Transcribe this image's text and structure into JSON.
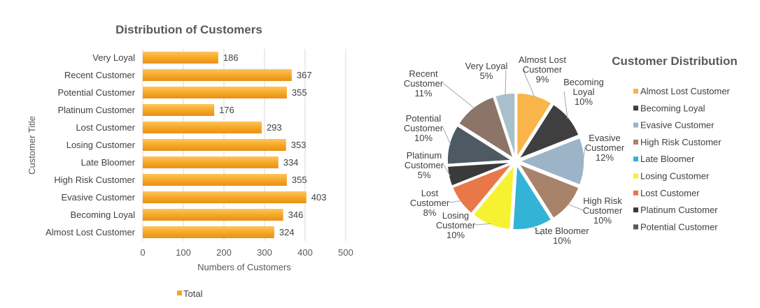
{
  "chart_data": [
    {
      "type": "bar",
      "orientation": "horizontal",
      "title": "Distribution of Customers",
      "xlabel": "Numbers of Customers",
      "ylabel": "Customer Title",
      "xlim": [
        0,
        500
      ],
      "xticks": [
        0,
        100,
        200,
        300,
        400,
        500
      ],
      "grid": true,
      "legend": "bottom",
      "categories": [
        "Very Loyal",
        "Recent Customer",
        "Potential Customer",
        "Platinum Customer",
        "Lost Customer",
        "Losing Customer",
        "Late Bloomer",
        "High Risk Customer",
        "Evasive Customer",
        "Becoming Loyal",
        "Almost Lost Customer"
      ],
      "series": [
        {
          "name": "Total",
          "color": "#f5a623",
          "values": [
            186,
            367,
            355,
            176,
            293,
            353,
            334,
            355,
            403,
            346,
            324
          ]
        }
      ]
    },
    {
      "type": "pie",
      "exploded": true,
      "title": "Customer Distribution",
      "legend": "right",
      "slices": [
        {
          "name": "Almost Lost Customer",
          "label_lines": [
            "Almost Lost",
            "Customer",
            "9%"
          ],
          "percent": 9,
          "color": "#f9b44a"
        },
        {
          "name": "Becoming Loyal",
          "label_lines": [
            "Becoming",
            "Loyal",
            "10%"
          ],
          "percent": 10,
          "color": "#3f3f3f"
        },
        {
          "name": "Evasive Customer",
          "label_lines": [
            "Evasive",
            "Customer",
            "12%"
          ],
          "percent": 12,
          "color": "#9db3c7"
        },
        {
          "name": "High Risk Customer",
          "label_lines": [
            "High Risk",
            "Customer",
            "10%"
          ],
          "percent": 10,
          "color": "#a9826a"
        },
        {
          "name": "Late Bloomer",
          "label_lines": [
            "Late Bloomer",
            "10%"
          ],
          "percent": 10,
          "color": "#33b3d6"
        },
        {
          "name": "Losing Customer",
          "label_lines": [
            "Losing",
            "Customer",
            "10%"
          ],
          "percent": 10,
          "color": "#f6f232"
        },
        {
          "name": "Lost Customer",
          "label_lines": [
            "Lost",
            "Customer",
            "8%"
          ],
          "percent": 8,
          "color": "#e8784a"
        },
        {
          "name": "Platinum Customer",
          "label_lines": [
            "Platinum",
            "Customer",
            "5%"
          ],
          "percent": 5,
          "color": "#3a3a3a"
        },
        {
          "name": "Potential Customer",
          "label_lines": [
            "Potential",
            "Customer",
            "10%"
          ],
          "percent": 10,
          "color": "#4d5a63"
        },
        {
          "name": "Recent Customer",
          "label_lines": [
            "Recent",
            "Customer",
            "11%"
          ],
          "percent": 11,
          "color": "#8c7468"
        },
        {
          "name": "Very Loyal",
          "label_lines": [
            "Very Loyal",
            "5%"
          ],
          "percent": 5,
          "color": "#a8bfcc"
        }
      ]
    }
  ]
}
